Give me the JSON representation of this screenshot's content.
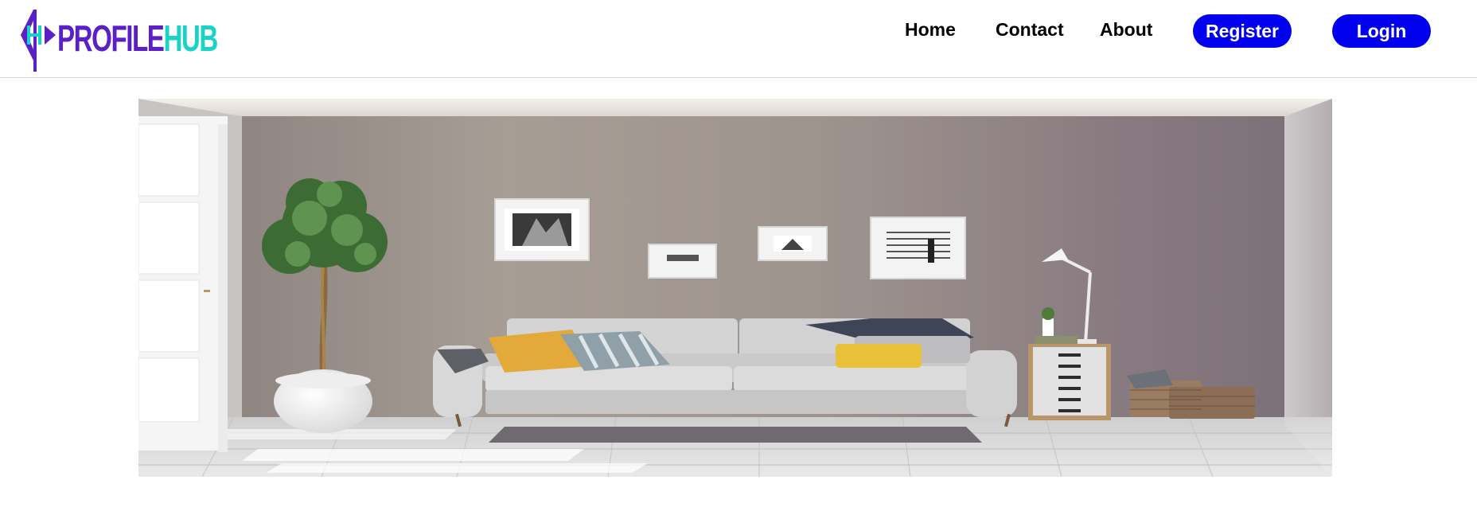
{
  "brand": {
    "logo_text_part1": "PROFILE",
    "logo_text_part2": "HUB",
    "logo_icon": "ph-monogram-icon",
    "colors": {
      "primary": "#5b1fc7",
      "accent": "#1ad3c7"
    }
  },
  "nav": {
    "links": [
      {
        "label": "Home"
      },
      {
        "label": "Contact"
      },
      {
        "label": "About"
      }
    ],
    "register_label": "Register",
    "login_label": "Login",
    "button_color": "#0000ee"
  },
  "hero": {
    "image": "living-room-photo"
  }
}
